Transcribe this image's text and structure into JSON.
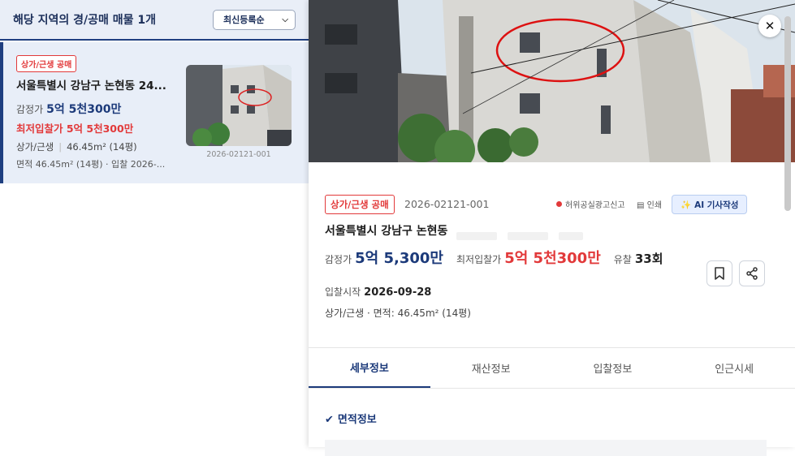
{
  "left_panel": {
    "title": "해당 지역의 경/공매 매물 1개",
    "sort": {
      "selected": "최신등록순"
    },
    "listing": {
      "badge": "상가/근생 공매",
      "address": "서울특별시 강남구 논현동 24...",
      "appraisal_label": "감정가",
      "appraisal_value": "5억 5천300만",
      "min_bid": "최저입찰가 5억 5천300만",
      "type": "상가/근생",
      "area": "46.45m² (14평)",
      "details": "면적 46.45m² (14평) · 입찰 2026-...",
      "case_id": "2026-02121-001"
    }
  },
  "detail": {
    "badge": "상가/근생 공매",
    "case_id": "2026-02121-001",
    "report_label": "허위공실광고신고",
    "print_label": "인쇄",
    "ai_label": "AI 기사작성",
    "address": "서울특별시 강남구 논현동",
    "appraisal_label": "감정가",
    "appraisal_value": "5억 5,300만",
    "min_bid_label": "최저입찰가",
    "min_bid_value": "5억 5천300만",
    "fail_label": "유찰",
    "fail_count": "33회",
    "bid_start_label": "입찰시작",
    "bid_start_value": "2026-09-28",
    "meta": "상가/근생 · 면적: 46.45m² (14평)",
    "tabs": [
      "세부정보",
      "재산정보",
      "입찰정보",
      "인근시세"
    ],
    "section_title": "면적정보"
  },
  "colors": {
    "navy": "#1c3a7a",
    "red": "#e2393a",
    "card_bg": "#e8eef8"
  },
  "icons": [
    "chevron-down-icon",
    "close-icon",
    "bookmark-icon",
    "share-icon",
    "sparkle-icon",
    "print-icon",
    "check-icon"
  ]
}
